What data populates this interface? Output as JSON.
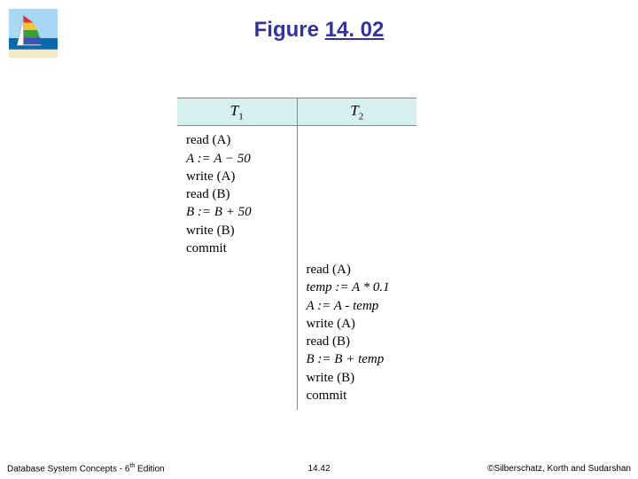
{
  "title_prefix": "Figure",
  "title_number": "14. 02",
  "schedule": {
    "headers": [
      "T1",
      "T2"
    ],
    "t1_ops": [
      "read (A)",
      "A := A − 50",
      "write (A)",
      "read (B)",
      "B := B + 50",
      "write (B)",
      "commit"
    ],
    "t2_ops": [
      "read (A)",
      "temp := A * 0.1",
      "A := A - temp",
      "write (A)",
      "read (B)",
      "B := B + temp",
      "write (B)",
      "commit"
    ]
  },
  "footer": {
    "left_prefix": "Database System Concepts - 6",
    "left_suffix": " Edition",
    "left_sup": "th",
    "center": "14.42",
    "right": "©Silberschatz, Korth and Sudarshan"
  },
  "logo_colors": {
    "sky": "#a9d8f5",
    "sea": "#0a6aa9",
    "sand": "#f2e7c8",
    "sail1": "#e03030",
    "sail2": "#f5c531",
    "sail3": "#3a9d3a",
    "sail4": "#3656b0"
  }
}
